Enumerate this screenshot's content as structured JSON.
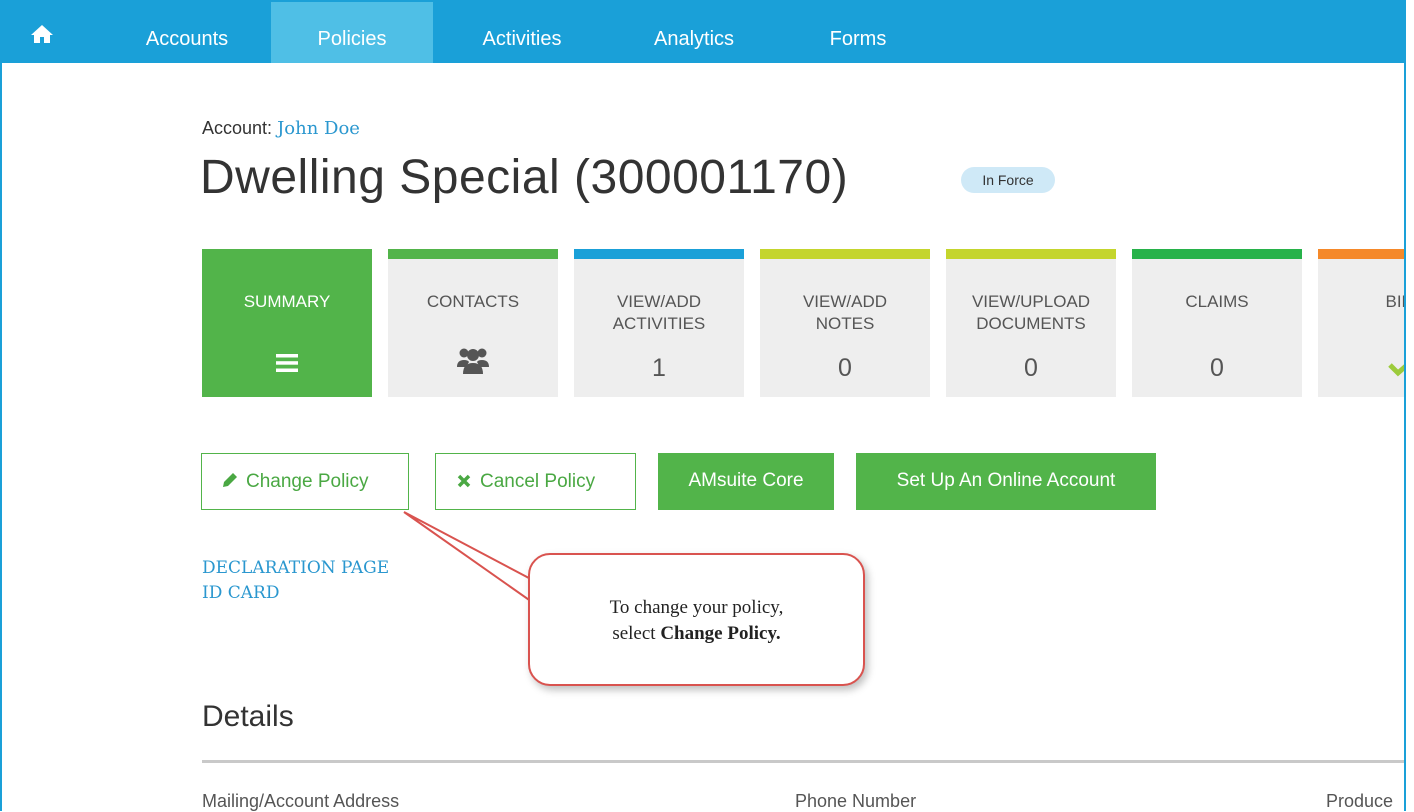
{
  "nav": {
    "home_icon": "home-icon",
    "items": [
      {
        "label": "Accounts"
      },
      {
        "label": "Policies"
      },
      {
        "label": "Activities"
      },
      {
        "label": "Analytics"
      },
      {
        "label": "Forms"
      }
    ],
    "active": "Policies"
  },
  "header": {
    "account_prefix": "Account:",
    "account_name": "John Doe",
    "title": "Dwelling Special (300001170)",
    "status": "In Force"
  },
  "tiles": [
    {
      "label": "SUMMARY",
      "icon": "menu-icon",
      "color": "#52b44a"
    },
    {
      "label": "CONTACTS",
      "icon": "users-icon",
      "color": "#52b44a"
    },
    {
      "label": "VIEW/ADD ACTIVITIES",
      "count": "1",
      "color": "#1aa0d8"
    },
    {
      "label": "VIEW/ADD NOTES",
      "count": "0",
      "color": "#c4d52d"
    },
    {
      "label": "VIEW/UPLOAD DOCUMENTS",
      "count": "0",
      "color": "#c4d52d"
    },
    {
      "label": "CLAIMS",
      "count": "0",
      "color": "#27b24a"
    },
    {
      "label": "BILL",
      "icon": "check-icon",
      "color": "#f5892a"
    }
  ],
  "actions": {
    "change_policy": "Change Policy",
    "cancel_policy": "Cancel Policy",
    "amsuite_core": "AMsuite Core",
    "setup_online": "Set Up An Online Account"
  },
  "links": {
    "declaration_page": "DECLARATION PAGE",
    "id_card": "ID CARD"
  },
  "callout": {
    "line1": "To change your policy,",
    "line2_prefix": "select",
    "line2_bold": "Change Policy."
  },
  "details": {
    "title": "Details",
    "columns": [
      "Mailing/Account Address",
      "Phone Number",
      "Produce"
    ]
  },
  "colors": {
    "brand_blue": "#1aa0d8",
    "active_tab": "#4fbfe6",
    "green": "#52b44a",
    "callout_border": "#d9534f"
  }
}
